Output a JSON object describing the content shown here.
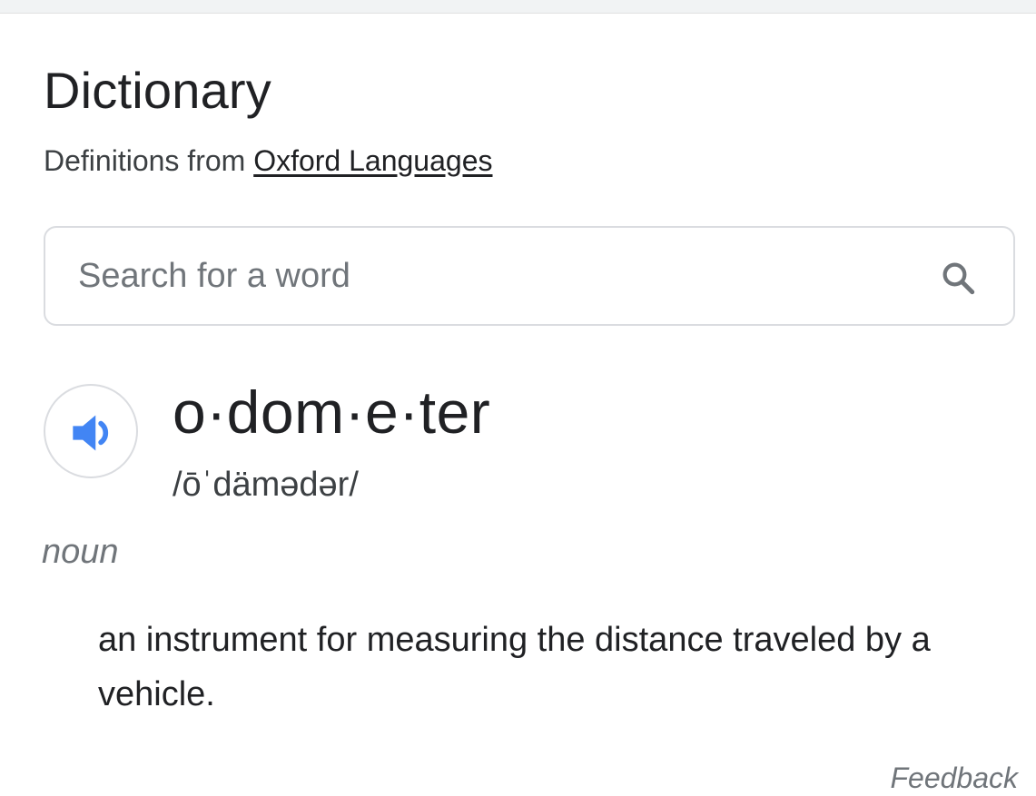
{
  "header": {
    "title": "Dictionary",
    "source_prefix": "Definitions from",
    "source_link": "Oxford Languages"
  },
  "search": {
    "placeholder": "Search for a word",
    "value": "",
    "icon": "search-icon"
  },
  "entry": {
    "audio_icon": "speaker-icon",
    "word": "o·dom·e·ter",
    "phonetic": "/ōˈdämədər/",
    "part_of_speech": "noun",
    "definition": "an instrument for measuring the distance traveled by a vehicle."
  },
  "footer": {
    "feedback": "Feedback"
  },
  "colors": {
    "accent": "#4285f4",
    "text": "#202124",
    "muted": "#70757a",
    "border": "#dadce0"
  }
}
